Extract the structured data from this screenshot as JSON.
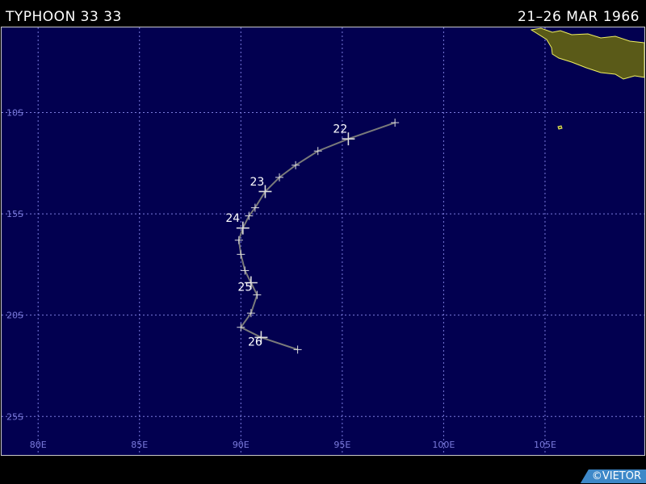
{
  "header": {
    "title": "TYPHOON 33 33",
    "dates": "21–26 MAR 1966"
  },
  "credit": "©VIETOR",
  "map": {
    "lon_range": [
      78.2,
      109.9
    ],
    "lat_range": [
      -26.9,
      -5.8
    ],
    "longitude_labels": [
      "80E",
      "85E",
      "90E",
      "95E",
      "100E",
      "105E"
    ],
    "latitude_labels": [
      "10S",
      "15S",
      "20S",
      "25S"
    ],
    "grid": true,
    "colors": {
      "ocean": "#020050",
      "grid": "#7b7bdc",
      "land": "#5a5a18",
      "coast": "#f0f060",
      "track": "#7a7a7a",
      "marker": "#dcdcdc",
      "label": "#ffffff"
    }
  },
  "track": {
    "points": [
      {
        "lon": 97.6,
        "lat": -10.5
      },
      {
        "lon": 95.3,
        "lat": -11.3
      },
      {
        "lon": 93.8,
        "lat": -11.9
      },
      {
        "lon": 92.7,
        "lat": -12.6
      },
      {
        "lon": 91.9,
        "lat": -13.2
      },
      {
        "lon": 91.2,
        "lat": -13.9
      },
      {
        "lon": 90.7,
        "lat": -14.7
      },
      {
        "lon": 90.4,
        "lat": -15.1
      },
      {
        "lon": 90.1,
        "lat": -15.7
      },
      {
        "lon": 89.9,
        "lat": -16.3
      },
      {
        "lon": 90.0,
        "lat": -17.0
      },
      {
        "lon": 90.2,
        "lat": -17.8
      },
      {
        "lon": 90.5,
        "lat": -18.4
      },
      {
        "lon": 90.8,
        "lat": -19.0
      },
      {
        "lon": 90.5,
        "lat": -19.9
      },
      {
        "lon": 90.0,
        "lat": -20.6
      },
      {
        "lon": 91.0,
        "lat": -21.1
      },
      {
        "lon": 92.8,
        "lat": -21.7
      }
    ],
    "day_labels": [
      {
        "text": "22",
        "lon": 95.3,
        "lat": -11.3,
        "dlon": -0.4,
        "dlat": 0.3
      },
      {
        "text": "23",
        "lon": 91.2,
        "lat": -13.9,
        "dlon": -0.4,
        "dlat": 0.3
      },
      {
        "text": "24",
        "lon": 89.9,
        "lat": -15.6,
        "dlon": -0.3,
        "dlat": 0.2
      },
      {
        "text": "25",
        "lon": 90.5,
        "lat": -18.4,
        "dlon": -0.3,
        "dlat": -0.4
      },
      {
        "text": "26",
        "lon": 91.0,
        "lat": -21.1,
        "dlon": -0.3,
        "dlat": -0.4
      }
    ],
    "major_marker_indices": [
      1,
      5,
      8,
      12,
      16
    ]
  }
}
